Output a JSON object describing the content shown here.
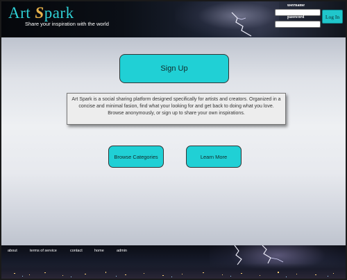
{
  "header": {
    "logo_left": "Art ",
    "logo_mark": "S",
    "logo_right": "park",
    "tagline": "Share your inspiration with the world",
    "username_label": "username",
    "password_label": "password",
    "username_value": "",
    "password_value": "",
    "login_label": "Log In"
  },
  "main": {
    "signup_label": "Sign Up",
    "about_text": "Art Spark is a social sharing platform designed specifically for artists and creators. Organized in a concise and minimal fasion, find what your looking for and get back to doing what you love. Browse anonymously, or sign up to share your own inspirations.",
    "browse_label": "Browse Categories",
    "learn_label": "Learn More"
  },
  "footer": {
    "links": [
      "about",
      "terms of service",
      "contact",
      "home",
      "admin"
    ]
  },
  "colors": {
    "accent": "#20d0d5",
    "logo": "#2fd0d5"
  }
}
